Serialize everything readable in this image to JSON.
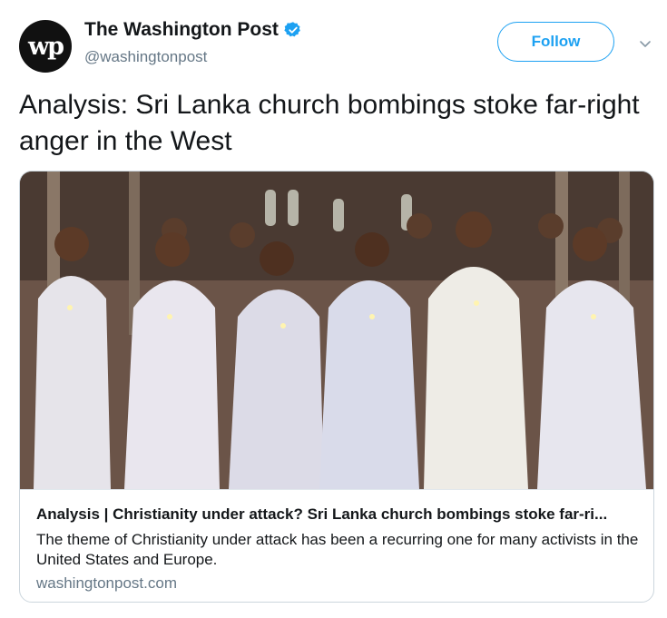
{
  "author": {
    "avatar_text": "wp",
    "name": "The Washington Post",
    "handle": "@washingtonpost",
    "verified": true
  },
  "actions": {
    "follow_label": "Follow"
  },
  "tweet": {
    "text": "Analysis: Sri Lanka church bombings stoke far-right anger in the West"
  },
  "card": {
    "image_alt": "Nuns and clergy holding candles in a church",
    "title": "Analysis | Christianity under attack? Sri Lanka church bombings stoke far-ri...",
    "description": "The theme of Christianity under attack has been a recurring one for many activists in the United States and Europe.",
    "domain": "washingtonpost.com"
  },
  "colors": {
    "accent": "#1da1f2",
    "text": "#14171a",
    "secondary": "#657786",
    "border": "#ccd6dd"
  },
  "icons": [
    "verified-badge-icon",
    "chevron-down-icon"
  ]
}
